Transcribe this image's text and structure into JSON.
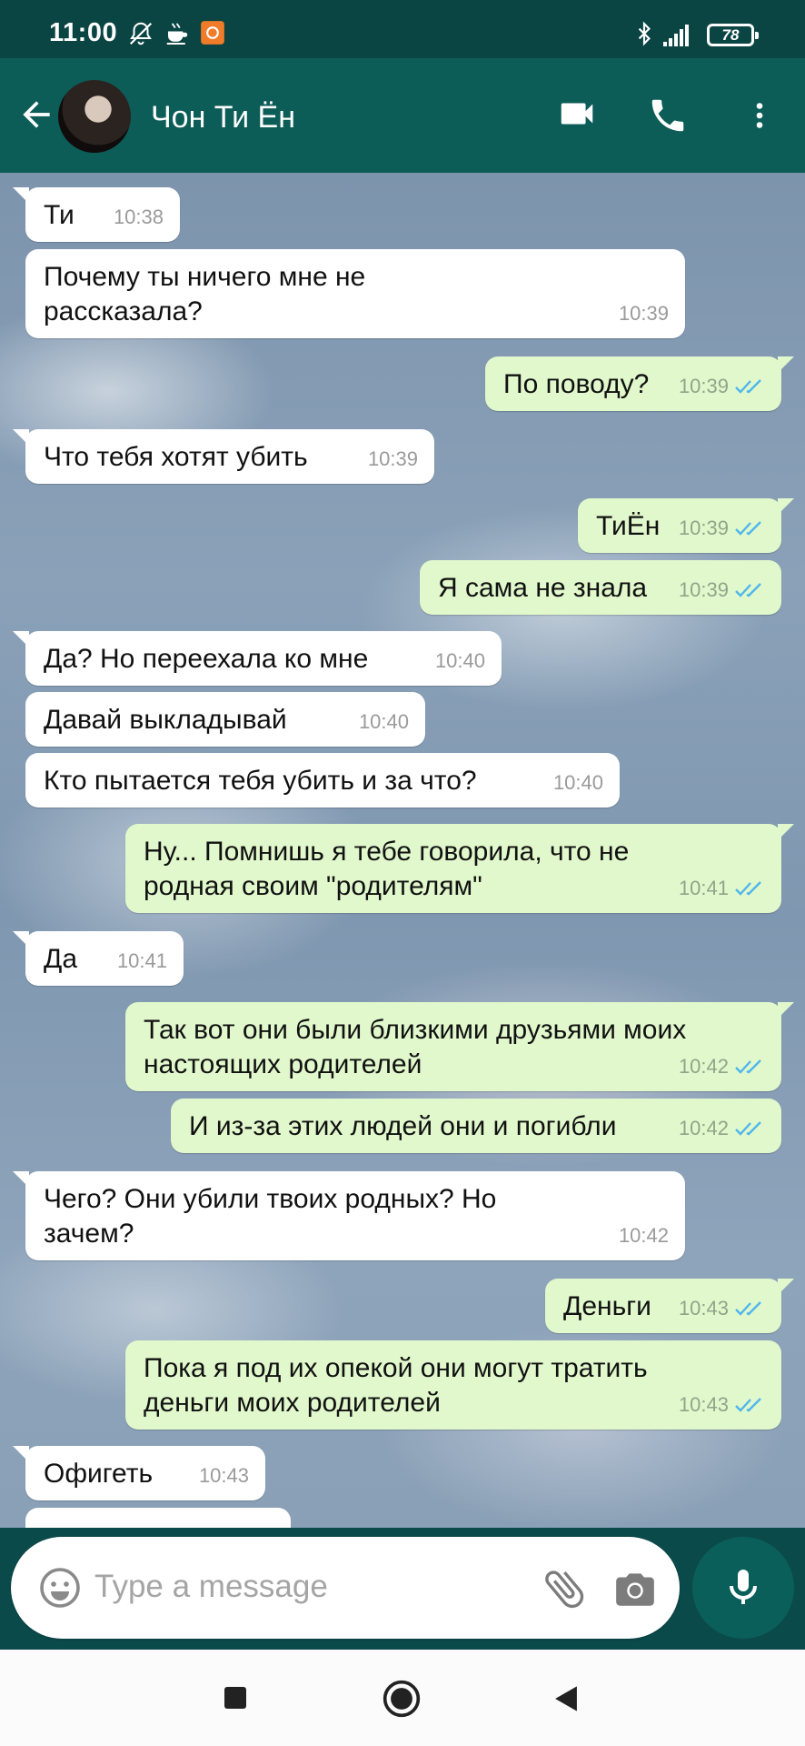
{
  "status_bar": {
    "time": "11:00",
    "battery": "78"
  },
  "header": {
    "contact_name": "Чон Ти Ён"
  },
  "messages": [
    {
      "dir": "in",
      "text": "Ти",
      "time": "10:38"
    },
    {
      "dir": "in",
      "text": "Почему ты ничего мне не\nрассказала?",
      "time": "10:39"
    },
    {
      "dir": "out",
      "text": "По поводу?",
      "time": "10:39"
    },
    {
      "dir": "in",
      "text": "Что тебя хотят убить",
      "time": "10:39"
    },
    {
      "dir": "out",
      "text": "ТиЁн",
      "time": "10:39"
    },
    {
      "dir": "out",
      "text": "Я сама не знала",
      "time": "10:39"
    },
    {
      "dir": "in",
      "text": "Да? Но переехала ко мне",
      "time": "10:40"
    },
    {
      "dir": "in",
      "text": "Давай выкладывай",
      "time": "10:40"
    },
    {
      "dir": "in",
      "text": "Кто пытается тебя убить и за что?",
      "time": "10:40"
    },
    {
      "dir": "out",
      "text": "Ну... Помнишь я тебе говорила, что не\nродная своим \"родителям\"",
      "time": "10:41"
    },
    {
      "dir": "in",
      "text": "Да",
      "time": "10:41"
    },
    {
      "dir": "out",
      "text": "Так вот они были близкими друзьями моих\nнастоящих родителей",
      "time": "10:42"
    },
    {
      "dir": "out",
      "text": "И из-за этих людей они и погибли",
      "time": "10:42"
    },
    {
      "dir": "in",
      "text": "Чего? Они убили твоих родных? Но\nзачем?",
      "time": "10:42"
    },
    {
      "dir": "out",
      "text": "Деньги",
      "time": "10:43"
    },
    {
      "dir": "out",
      "text": "Пока я под их опекой они могут тратить\nденьги моих родителей",
      "time": "10:43"
    },
    {
      "dir": "in",
      "text": "Офигеть",
      "time": "10:43"
    }
  ],
  "composer": {
    "placeholder": "Type a message"
  },
  "icons": {
    "back": "arrow-left-icon",
    "video": "video-camera-icon",
    "call": "phone-icon",
    "menu": "more-vert-icon",
    "emoji": "emoji-icon",
    "attach": "paperclip-icon",
    "camera": "camera-icon",
    "mic": "microphone-icon",
    "read": "double-check-icon"
  },
  "colors": {
    "header": "#0c5c58",
    "status_bar": "#0b4543",
    "outgoing_bubble": "#e1f8cc",
    "incoming_bubble": "#ffffff",
    "read_ticks": "#4fb6ec",
    "mic_button": "#0a5f5b"
  }
}
